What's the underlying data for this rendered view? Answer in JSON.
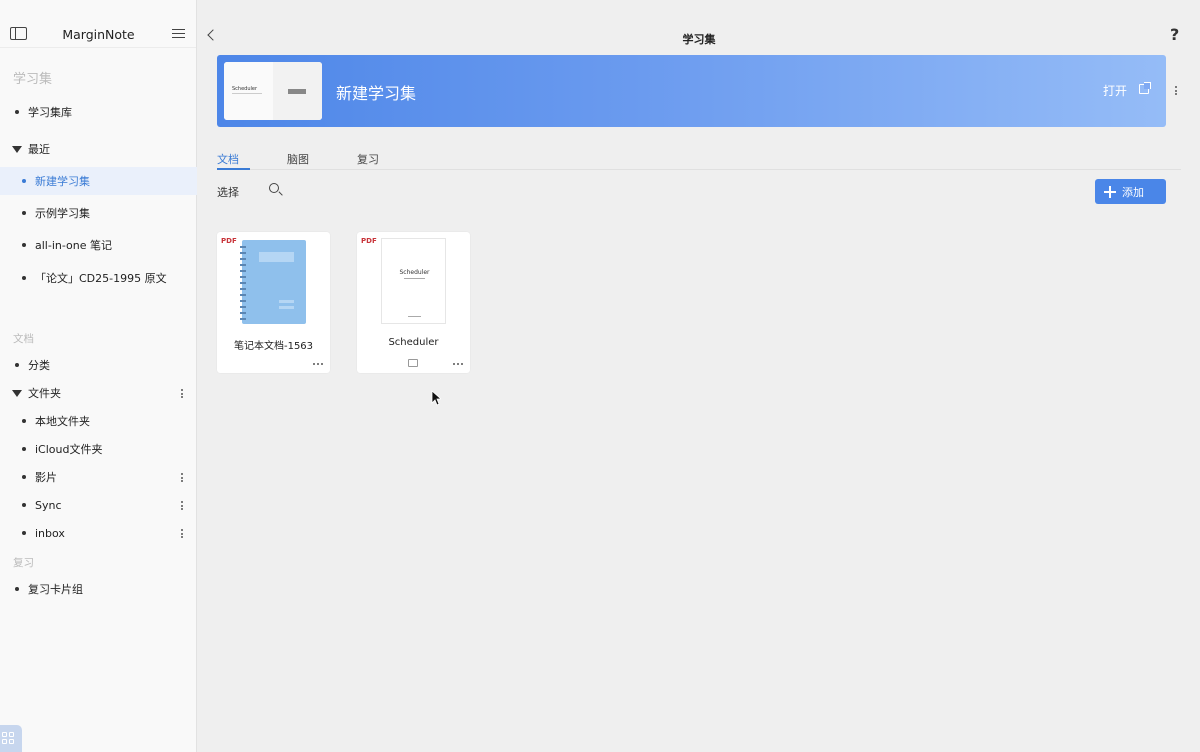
{
  "sidebar": {
    "app_title": "MarginNote",
    "section_notebooks": "学习集",
    "notebook_library": "学习集库",
    "recent_label": "最近",
    "recent_items": [
      {
        "label": "新建学习集"
      },
      {
        "label": "示例学习集"
      },
      {
        "label": "all-in-one 笔记"
      },
      {
        "label": "「论文」CD25-1995 原文"
      }
    ],
    "section_documents": "文档",
    "categories_label": "分类",
    "folders_label": "文件夹",
    "folder_items": [
      {
        "label": "本地文件夹"
      },
      {
        "label": "iCloud文件夹"
      },
      {
        "label": "影片"
      },
      {
        "label": "Sync"
      },
      {
        "label": "inbox"
      }
    ],
    "section_review": "复习",
    "review_cards_label": "复习卡片组"
  },
  "header": {
    "title": "学习集",
    "help": "?"
  },
  "banner": {
    "notebook_title": "新建学习集",
    "open_label": "打开",
    "thumb_title": "Scheduler"
  },
  "tabs": [
    {
      "label": "文档"
    },
    {
      "label": "脑图"
    },
    {
      "label": "复习"
    }
  ],
  "toolbar": {
    "select_label": "选择",
    "add_label": "添加"
  },
  "documents": [
    {
      "type": "PDF",
      "name": "笔记本文档-1563"
    },
    {
      "type": "PDF",
      "name": "Scheduler",
      "cover_title": "Scheduler"
    }
  ],
  "colors": {
    "accent": "#3a7bd5",
    "banner_start": "#4d86e8",
    "banner_end": "#95bcf7",
    "pdf_red": "#c8343a",
    "notebook_cover": "#8fc0ec"
  }
}
